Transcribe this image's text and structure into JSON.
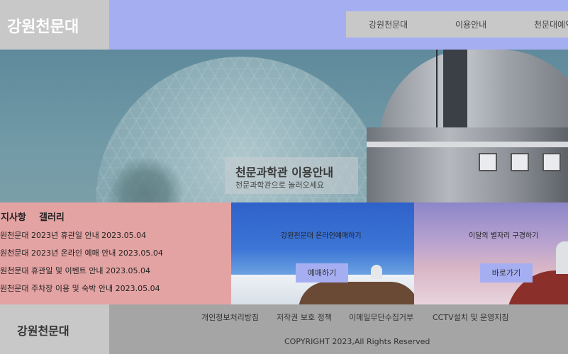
{
  "header": {
    "logo": "강원천문대",
    "nav": [
      "강원천문대",
      "이용안내",
      "천문대예약"
    ]
  },
  "hero": {
    "title": "천문과학관 이용안내",
    "subtitle": "천문과학관으로 놀러오세요"
  },
  "notice": {
    "tabs": [
      "지사항",
      "갤러리"
    ],
    "items": [
      "원천문대 2023년 휴관일 안내 2023.05.04",
      "원천문대 2023년 온라인 예매 안내 2023.05.04",
      "원천문대 휴관일 및 이벤트 안내 2023.05.04",
      "원천문대 주차장 이용 및 숙박 안내 2023.05.04"
    ]
  },
  "cards": [
    {
      "title": "강원천문대 온라인예매하기",
      "button": "예매하기"
    },
    {
      "title": "이달의 별자리 구경하기",
      "button": "바로가기"
    }
  ],
  "footer": {
    "logo": "강원천문대",
    "links": [
      "개인정보처리방침",
      "저작권 보호 정책",
      "이메일무단수집거부",
      "CCTV설치 및 운영지침"
    ],
    "copyright": "COPYRIGHT 2023,All Rights Reserved"
  },
  "colors": {
    "header_bg": "#a6aef2",
    "logo_box": "#c8c8c8",
    "notice_bg": "#e4a3a3",
    "footer_bg": "#a5a5a5",
    "button_bg": "#a6aef2"
  }
}
